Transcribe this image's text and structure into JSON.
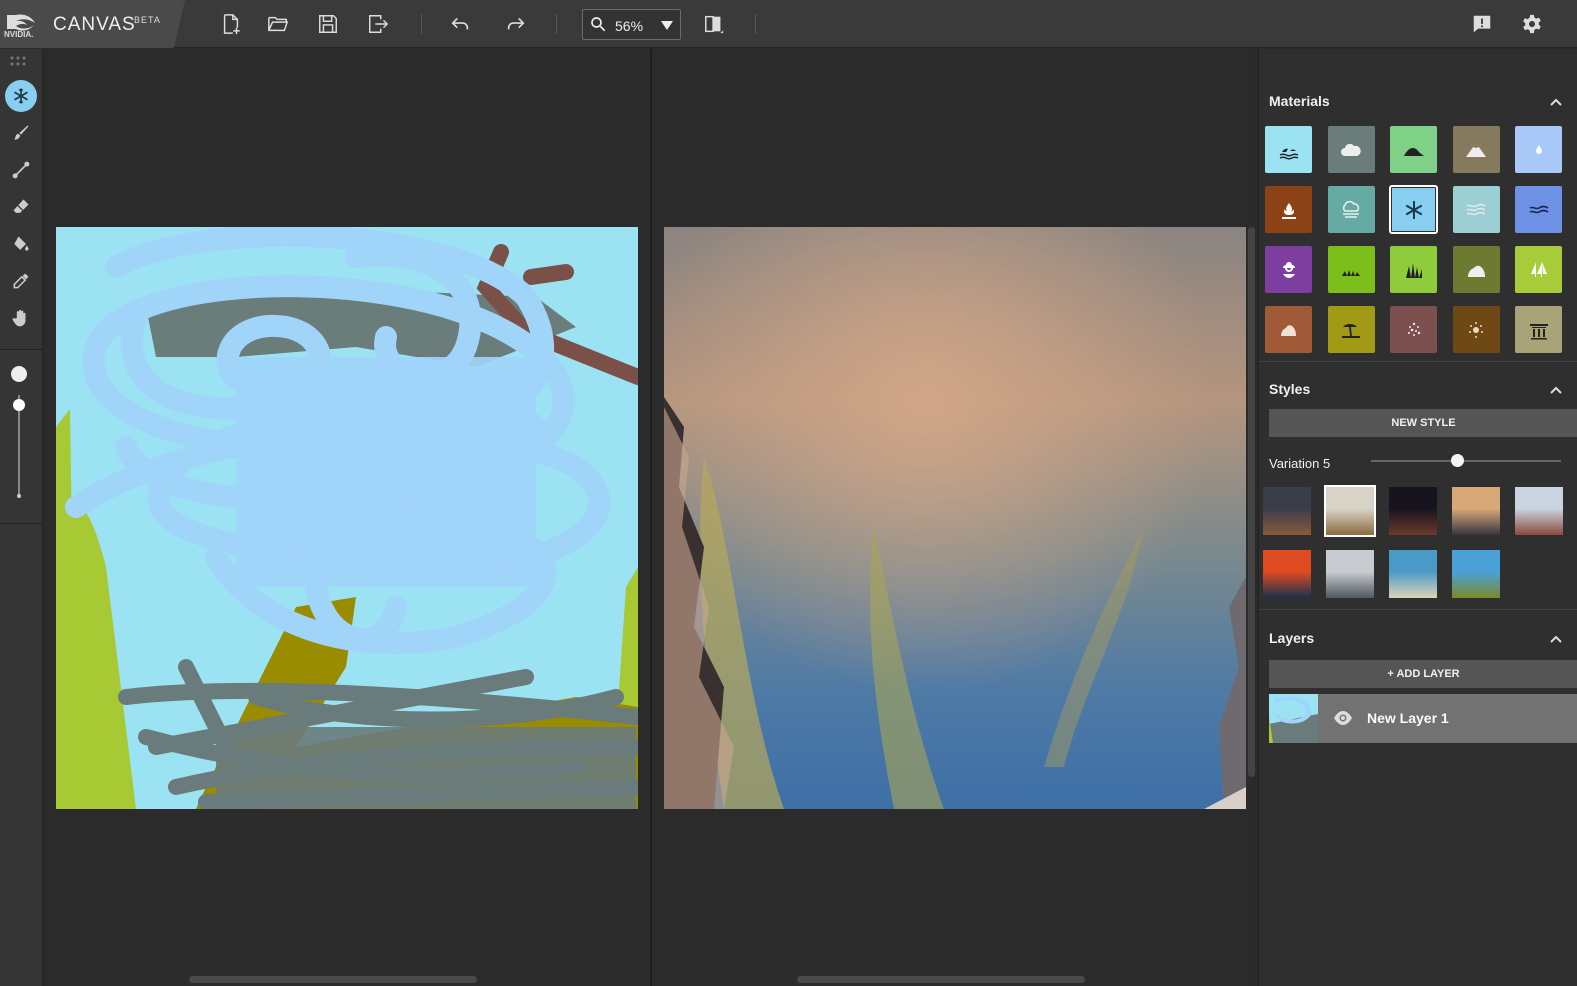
{
  "app": {
    "logo_text": "NVIDIA.",
    "name": "CANVAS",
    "badge": "BETA"
  },
  "toolbar": {
    "buttons": [
      "new-file-icon",
      "open-folder-icon",
      "save-icon",
      "export-icon",
      "undo-icon",
      "redo-icon",
      "compare-icon"
    ],
    "zoom_value": "56%",
    "right_buttons": [
      "feedback-icon",
      "gear-icon"
    ]
  },
  "tools": [
    "material-tool-icon",
    "brush-icon",
    "line-icon",
    "eraser-icon",
    "fill-bucket-icon",
    "eyedropper-icon",
    "hand-icon"
  ],
  "brush_size": {
    "level": 0.9
  },
  "materials": {
    "title": "Materials",
    "items": [
      {
        "name": "sea",
        "color": "#9be3f2"
      },
      {
        "name": "cloud",
        "color": "#6a7d7b"
      },
      {
        "name": "hill",
        "color": "#7fd187"
      },
      {
        "name": "mountain",
        "color": "#857a5e"
      },
      {
        "name": "water",
        "color": "#a8c8f8"
      },
      {
        "name": "fire",
        "color": "#8b4315"
      },
      {
        "name": "fog",
        "color": "#66aba3"
      },
      {
        "name": "snow",
        "color": "#87cef0",
        "selected": true
      },
      {
        "name": "river",
        "color": "#9bcfd4"
      },
      {
        "name": "lake",
        "color": "#6e91e6"
      },
      {
        "name": "flower",
        "color": "#7e3ea0"
      },
      {
        "name": "grass",
        "color": "#7cbf1a"
      },
      {
        "name": "tall-grass",
        "color": "#8ecc3c"
      },
      {
        "name": "rock",
        "color": "#6c7a32"
      },
      {
        "name": "tree",
        "color": "#a6cc3a"
      },
      {
        "name": "sand",
        "color": "#a05a37"
      },
      {
        "name": "beach",
        "color": "#a09a14"
      },
      {
        "name": "gravel",
        "color": "#7d5050"
      },
      {
        "name": "dirt",
        "color": "#6e4916"
      },
      {
        "name": "building",
        "color": "#a9a478"
      }
    ]
  },
  "styles": {
    "title": "Styles",
    "new_style_label": "NEW STYLE",
    "variation_label": "Variation 5",
    "variation_level": 0.45,
    "thumbs": [
      {
        "name": "desert-mesa",
        "c1": "#3a3d4a",
        "c2": "#8a5a3a"
      },
      {
        "name": "cloud-peaks",
        "c1": "#d9d4c8",
        "c2": "#8a6a40",
        "selected": true
      },
      {
        "name": "night-arch",
        "c1": "#171420",
        "c2": "#6a3a2a"
      },
      {
        "name": "sunset-fog",
        "c1": "#d8a878",
        "c2": "#3a3440"
      },
      {
        "name": "red-cliffs",
        "c1": "#c9d4e0",
        "c2": "#8a4a3a"
      },
      {
        "name": "ocean-sunset",
        "c1": "#e04a20",
        "c2": "#1a3050"
      },
      {
        "name": "snowy-mountain",
        "c1": "#c8ccd0",
        "c2": "#505860"
      },
      {
        "name": "tropical-shore",
        "c1": "#4a9ac8",
        "c2": "#e0d4b8"
      },
      {
        "name": "alpine-lake",
        "c1": "#4aa0d8",
        "c2": "#7a8a2a"
      }
    ]
  },
  "layers": {
    "title": "Layers",
    "add_label": "+ ADD LAYER",
    "items": [
      {
        "name": "New Layer 1"
      }
    ]
  }
}
